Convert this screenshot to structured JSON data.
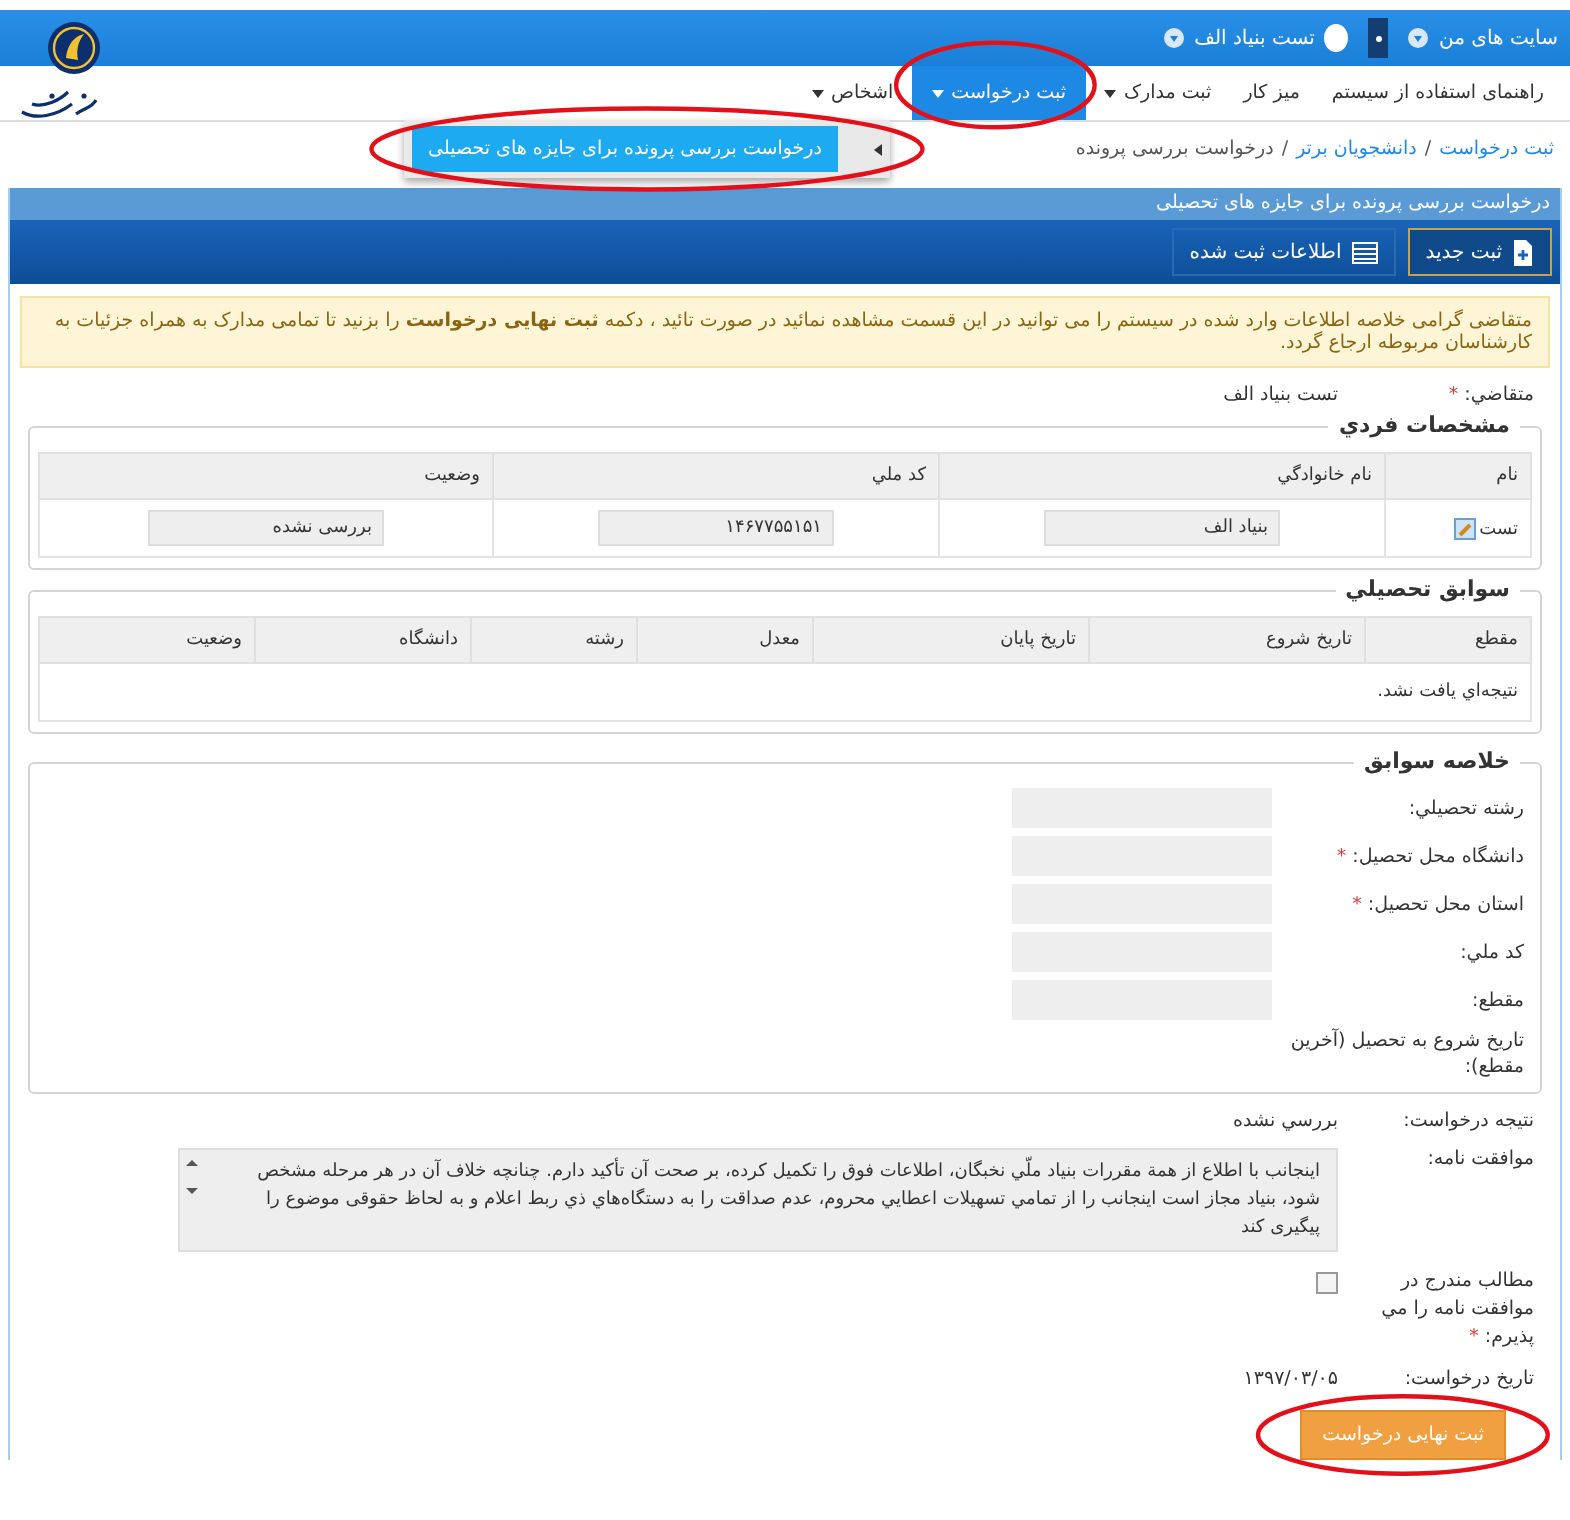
{
  "topbar": {
    "sites_menu": "سایت های من",
    "user_name": "تست بنیاد الف"
  },
  "nav": [
    {
      "label": "راهنمای استفاده از سیستم",
      "has_menu": false,
      "selected": false,
      "circled": false
    },
    {
      "label": "میز کار",
      "has_menu": false,
      "selected": false,
      "circled": false
    },
    {
      "label": "ثبت مدارک",
      "has_menu": true,
      "selected": false,
      "circled": false
    },
    {
      "label": "ثبت درخواست",
      "has_menu": true,
      "selected": true,
      "circled": true
    },
    {
      "label": "اشخاص",
      "has_menu": true,
      "selected": false,
      "circled": false
    }
  ],
  "submenu": {
    "items": [
      {
        "label": "درخواست بررسی پرونده برای جایزه های تحصیلی",
        "selected": true,
        "circled": true
      }
    ]
  },
  "required_mark": "*",
  "breadcrumb": {
    "separator": "/",
    "items": [
      {
        "kind": "link",
        "label": "ثبت درخواست"
      },
      {
        "kind": "link",
        "label": "دانشجویان برتر"
      },
      {
        "kind": "current",
        "label": "درخواست بررسی پرونده"
      }
    ]
  },
  "panel": {
    "title": "درخواست بررسی پرونده برای جایزه های تحصیلی",
    "toolbar": [
      {
        "kind": "new",
        "label": "ثبت جدید",
        "selected": true
      },
      {
        "kind": "list",
        "label": "اطلاعات ثبت شده",
        "selected": false
      }
    ]
  },
  "alert": "متقاضی گرامی خلاصه اطلاعات وارد شده در سیستم را می توانید در این قسمت مشاهده نمائید در صورت تائید ، دکمه **ثبت نهایی درخواست** را بزنید تا تمامی مدارک به همراه جزئیات به کارشناسان مربوطه ارجاع گردد.",
  "applicant": {
    "label": "متقاضي:",
    "required": true,
    "value": "تست بنیاد الف"
  },
  "personal": {
    "title": "مشخصات فردي",
    "columns": [
      "نام",
      "نام خانوادگي",
      "کد ملي",
      "وضعيت"
    ],
    "rows": [
      {
        "cells": [
          {
            "kind": "name",
            "text": "تست"
          },
          {
            "kind": "field",
            "text": "بنیاد الف"
          },
          {
            "kind": "field",
            "text": "۱۴۶۷۷۵۵۱۵۱"
          },
          {
            "kind": "field",
            "text": "بررسی نشده"
          }
        ]
      }
    ]
  },
  "education": {
    "title": "سوابق تحصيلي",
    "columns": [
      "مقطع",
      "تاريخ شروع",
      "تاريخ پايان",
      "معدل",
      "رشته",
      "دانشگاه",
      "وضعيت"
    ],
    "empty_text": "نتيجه‌اي يافت نشد."
  },
  "summary": {
    "title": "خلاصه سوابق",
    "fields": [
      {
        "kind": "input",
        "label": "رشته تحصيلي:",
        "required": false
      },
      {
        "kind": "input",
        "label": "دانشگاه محل تحصيل:",
        "required": true
      },
      {
        "kind": "input",
        "label": "استان محل تحصيل:",
        "required": true
      },
      {
        "kind": "input",
        "label": "کد ملي:",
        "required": false
      },
      {
        "kind": "input",
        "label": "مقطع:",
        "required": false
      },
      {
        "kind": "text",
        "label": "تاريخ شروع به تحصيل (آخرين مقطع):",
        "required": false
      }
    ]
  },
  "result": {
    "label": "نتيجه درخواست:",
    "value": "بررسي نشده"
  },
  "agreement": {
    "label": "موافقت نامه:",
    "text": "اينجانب با اطلاع از همة مقررات بنياد ملّي نخبگان، اطلاعات فوق را تکميل کرده، بر صحت آن تأکيد دارم. چنانچه خلاف آن در هر مرحله مشخص شود، بنياد مجاز است اينجانب را از تمامي تسهيلات اعطايي محروم، عدم صداقت را به دستگاه‌هاي ذي ربط اعلام و به لحاظ حقوقی موضوع را پيگيری کند"
  },
  "accept": {
    "label": "مطالب مندرج در موافقت نامه را مي پذيرم:",
    "required": true,
    "checked": false
  },
  "date": {
    "label": "تاريخ درخواست:",
    "value": "۱۳۹۷/۰۳/۰۵"
  },
  "submit": {
    "label": "ثبت نهایی درخواست",
    "circled": true
  }
}
